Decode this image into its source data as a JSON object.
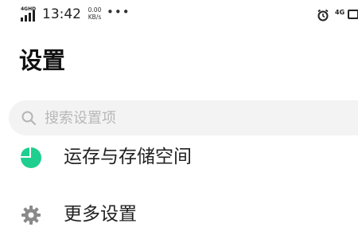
{
  "status_bar": {
    "network_left": "4GHD",
    "time": "13:42",
    "speed_value": "0.00",
    "speed_unit": "KB/s",
    "more": "•••",
    "network_right": "4G",
    "icons": [
      "signal-icon",
      "alarm-icon",
      "battery-icon"
    ]
  },
  "page": {
    "title": "设置"
  },
  "search": {
    "placeholder": "搜索设置项",
    "value": ""
  },
  "settings_items": [
    {
      "label": "运存与存储空间",
      "icon": "storage-pie-icon",
      "icon_color": "#1ecf8f"
    },
    {
      "label": "更多设置",
      "icon": "gear-icon",
      "icon_color": "#8a8a8a"
    }
  ]
}
